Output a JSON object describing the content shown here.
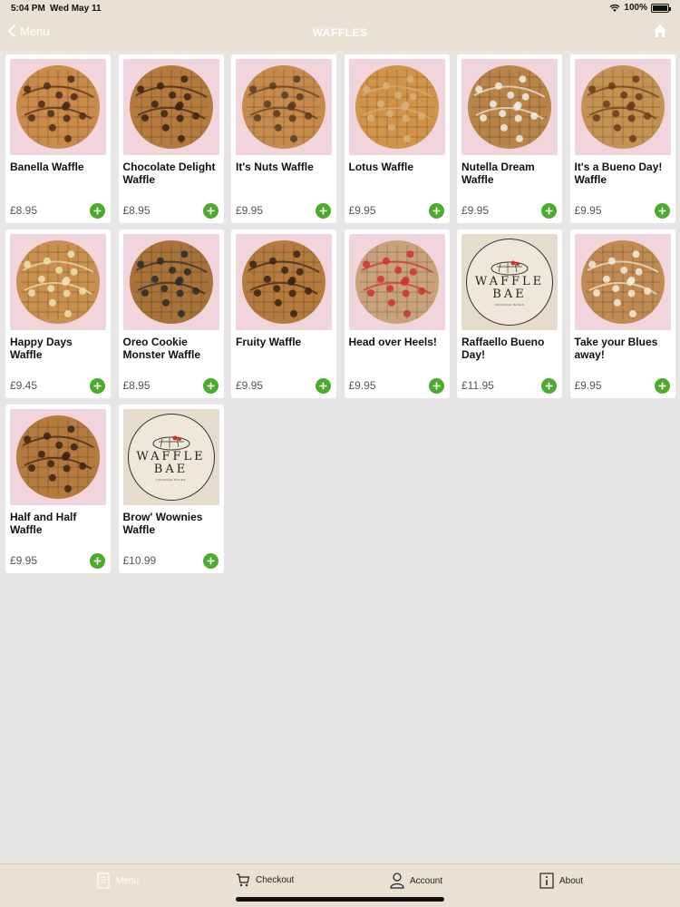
{
  "status": {
    "time": "5:04 PM",
    "date": "Wed May 11",
    "battery": "100%"
  },
  "nav": {
    "back_label": "Menu",
    "title": "WAFFLES"
  },
  "items": [
    {
      "name": "Banella Waffle",
      "price": "£8.95",
      "thumb": "waffle-photo"
    },
    {
      "name": "Chocolate Delight Waffle",
      "price": "£8.95",
      "thumb": "waffle-photo"
    },
    {
      "name": "It's Nuts Waffle",
      "price": "£9.95",
      "thumb": "waffle-photo"
    },
    {
      "name": "Lotus Waffle",
      "price": "£9.95",
      "thumb": "waffle-photo"
    },
    {
      "name": "Nutella Dream Waffle",
      "price": "£9.95",
      "thumb": "waffle-photo"
    },
    {
      "name": "It's a Bueno Day! Waffle",
      "price": "£9.95",
      "thumb": "waffle-photo"
    },
    {
      "name": "Happy Days Waffle",
      "price": "£9.45",
      "thumb": "waffle-photo"
    },
    {
      "name": "Oreo Cookie Monster Waffle",
      "price": "£8.95",
      "thumb": "waffle-photo"
    },
    {
      "name": "Fruity Waffle",
      "price": "£9.95",
      "thumb": "waffle-photo"
    },
    {
      "name": "Head over Heels!",
      "price": "£9.95",
      "thumb": "waffle-photo"
    },
    {
      "name": "Raffaello Bueno Day!",
      "price": "£11.95",
      "thumb": "brand-logo"
    },
    {
      "name": "Take your Blues away!",
      "price": "£9.95",
      "thumb": "waffle-photo"
    },
    {
      "name": "Half and Half Waffle",
      "price": "£9.95",
      "thumb": "waffle-photo"
    },
    {
      "name": "Brow' Wownies Waffle",
      "price": "£10.99",
      "thumb": "brand-logo"
    }
  ],
  "logo": {
    "line1": "WAFFLE",
    "line2": "BAE",
    "tagline": "FROMAGE BAKES"
  },
  "tabs": {
    "menu": "Menu",
    "checkout": "Checkout",
    "account": "Account",
    "about": "About"
  },
  "colors": {
    "bar_bg": "#e9e1d3",
    "add_green": "#4caa2c",
    "page_bg": "#e7e5e5"
  }
}
